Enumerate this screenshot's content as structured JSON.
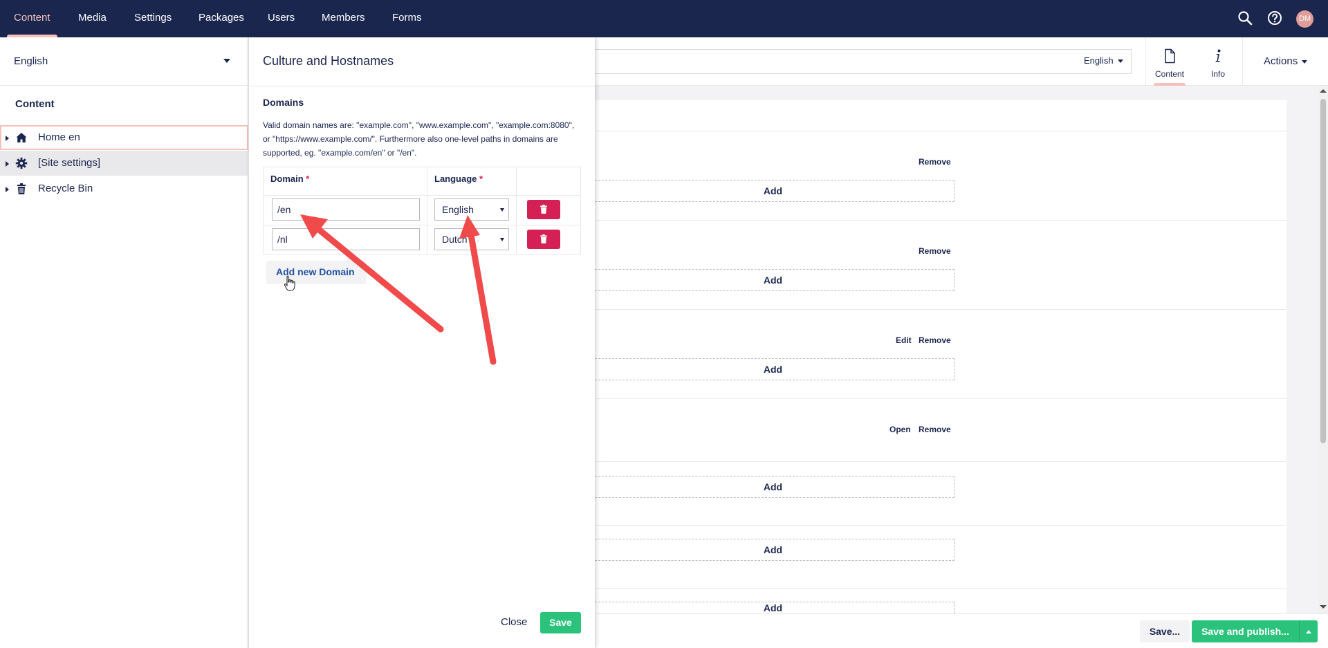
{
  "nav": {
    "items": [
      "Content",
      "Media",
      "Settings",
      "Packages",
      "Users",
      "Members",
      "Forms"
    ],
    "active": "Content",
    "search_icon": "search-icon",
    "help_icon": "help-icon",
    "avatar_initials": "DM"
  },
  "sidebar": {
    "language": "English",
    "tree_title": "Content",
    "items": [
      {
        "label": "Home en",
        "icon": "home-icon"
      },
      {
        "label": "[Site settings]",
        "icon": "gear-icon"
      },
      {
        "label": "Recycle Bin",
        "icon": "trash-icon"
      }
    ]
  },
  "editor": {
    "variant_language": "English",
    "tabs": [
      {
        "label": "Content",
        "icon": "document-icon"
      },
      {
        "label": "Info",
        "icon": "info-icon"
      }
    ],
    "actions_label": "Actions",
    "blocks": [
      {
        "add_label": "Add",
        "actions": [
          "Remove"
        ]
      },
      {
        "add_label": "Add",
        "actions": [
          "Remove"
        ]
      },
      {
        "add_label": "Add",
        "actions": [
          "Edit",
          "Remove"
        ]
      },
      {
        "add_label": "Add",
        "actions": [
          "Open",
          "Remove"
        ]
      },
      {
        "add_label": "Add",
        "actions": []
      },
      {
        "add_label": "Add",
        "actions": []
      },
      {
        "add_label": "Add",
        "actions": []
      }
    ],
    "footer": {
      "save_label": "Save...",
      "publish_label": "Save and publish..."
    }
  },
  "dialog": {
    "title": "Culture and Hostnames",
    "section_title": "Domains",
    "help_text": "Valid domain names are: \"example.com\", \"www.example.com\", \"example.com:8080\", or \"https://www.example.com/\". Furthermore also one-level paths in domains are supported, eg. \"example.com/en\" or \"/en\".",
    "columns": {
      "domain": "Domain",
      "language": "Language",
      "required_mark": "*"
    },
    "rows": [
      {
        "domain": "/en",
        "language": "English"
      },
      {
        "domain": "/nl",
        "language": "Dutch"
      }
    ],
    "add_domain_label": "Add new Domain",
    "close_label": "Close",
    "save_label": "Save"
  },
  "colors": {
    "topbar": "#1b264f",
    "nav_active": "#f5c1bc",
    "primary_green": "#2bc37c",
    "danger": "#d42054",
    "link_blue": "#2152a3",
    "annotation_arrow": "#f04a4a"
  }
}
